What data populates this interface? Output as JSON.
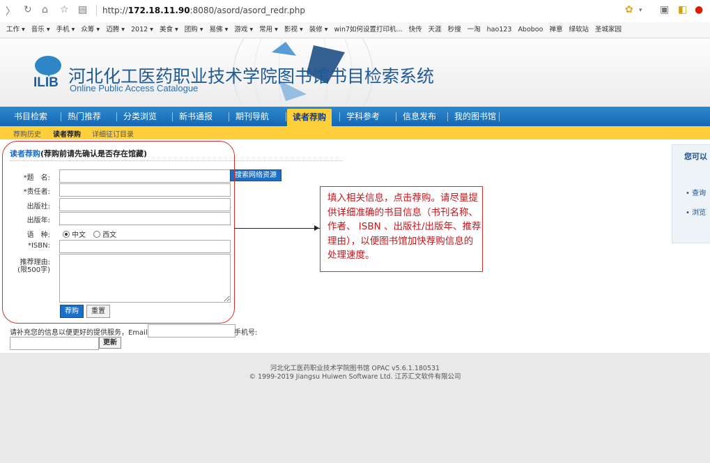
{
  "browser": {
    "url_prefix": "http://",
    "url_host": "172.18.11.90",
    "url_rest": ":8080/asord/asord_redr.php",
    "bookmarks": [
      "工作 ▾",
      "音乐 ▾",
      "手机 ▾",
      "众筹 ▾",
      "迈腾 ▾",
      "2012 ▾",
      "美食 ▾",
      "团购 ▾",
      "易佛 ▾",
      "游戏 ▾",
      "常用 ▾",
      "影视 ▾",
      "装修 ▾",
      "win7如何设置打印机...",
      "快传",
      "天涯",
      "秒搜",
      "一淘",
      "hao123",
      "Aboboo",
      "禅意",
      "绿软站",
      "圣城家园"
    ]
  },
  "header": {
    "logo": "ILIB",
    "title": "河北化工医药职业技术学院图书馆书目检索系统",
    "subtitle": "Online Public Access Catalogue"
  },
  "mainnav": [
    "书目检索",
    "热门推荐",
    "分类浏览",
    "新书通报",
    "期刊导航",
    "读者荐购",
    "学科参考",
    "信息发布",
    "我的图书馆"
  ],
  "mainnav_active": "读者荐购",
  "subnav": [
    "荐购历史",
    "读者荐购",
    "详细征订目录"
  ],
  "form": {
    "heading_hl": "读者荐购",
    "heading_rest": "(荐购前请先确认是否存在馆藏)",
    "labels": {
      "title": "*题　名:",
      "author": "*责任者:",
      "publisher": "出版社:",
      "year": "出版年:",
      "language": "语　种:",
      "isbn": "*ISBN:",
      "reason": "推荐理由:",
      "reason_limit": "(限500字)"
    },
    "web_search": "搜索网络资源",
    "lang_cn": "中文",
    "lang_west": "西文",
    "submit": "荐购",
    "reset": "重置"
  },
  "contact": {
    "text": "请补充您的信息以便更好的提供服务，Email:",
    "phone": "手机号:",
    "update": "更新"
  },
  "annotation": "填入相关信息，点击荐购。请尽量提供详细准确的书目信息（书刊名称、作者、 ISBN 、出版社/出版年、推荐理由），以便图书馆加快荐购信息的处理速度。",
  "right_panel": {
    "title": "您可以",
    "items": [
      "• 查询",
      "• 浏览"
    ]
  },
  "footer": {
    "line1": "河北化工医药职业技术学院图书馆  OPAC v5.6.1.180531",
    "line2": "© 1999-2019 Jiangsu Huiwen Software Ltd. 江苏汇文软件有限公司"
  }
}
